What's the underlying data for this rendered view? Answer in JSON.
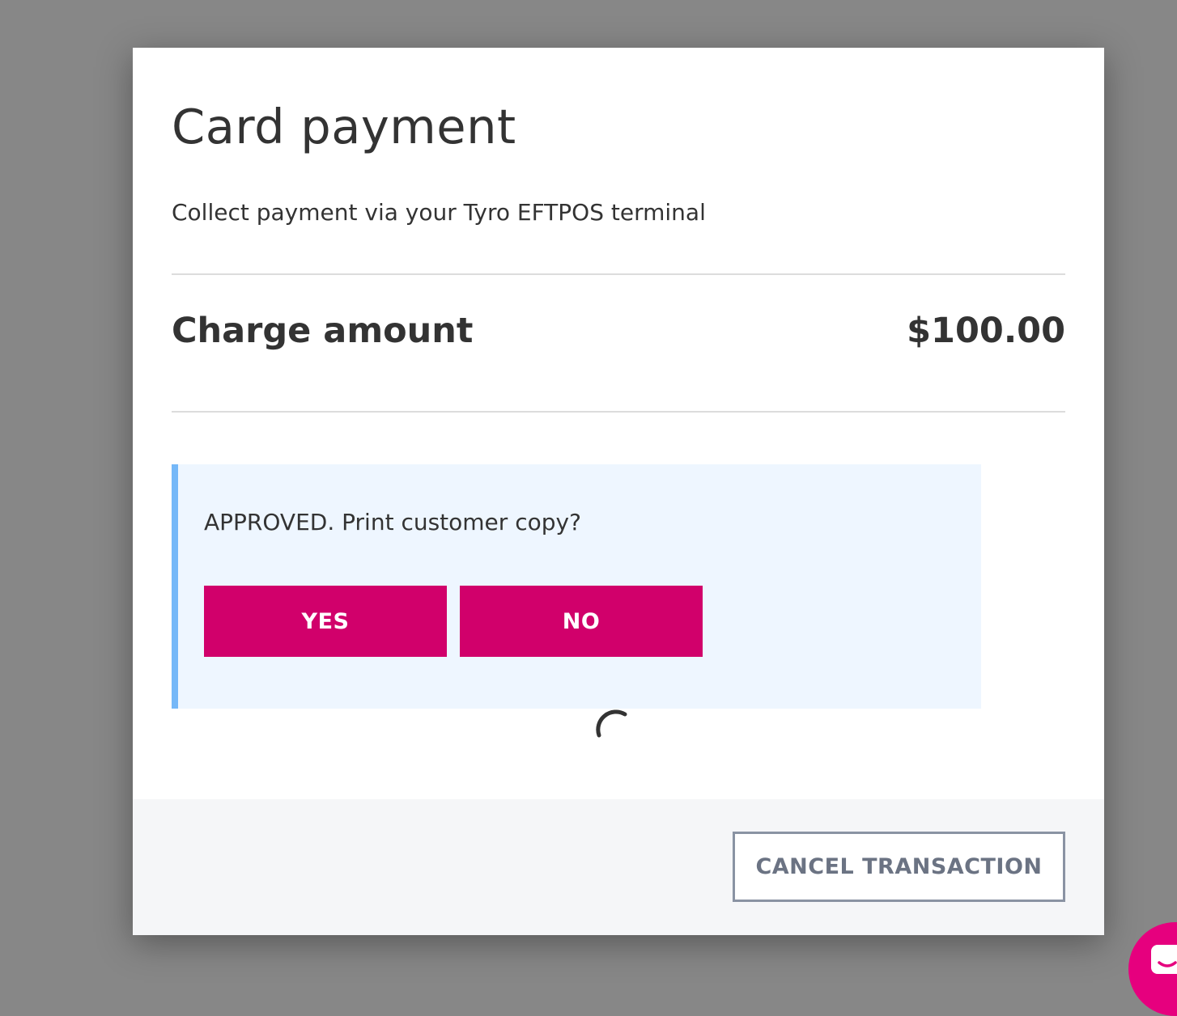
{
  "modal": {
    "title": "Card payment",
    "subtitle": "Collect payment via your Tyro EFTPOS terminal",
    "charge": {
      "label": "Charge amount",
      "value": "$100.00"
    },
    "notice": {
      "message": "APPROVED. Print customer copy?",
      "yes_label": "YES",
      "no_label": "NO"
    },
    "spinner_icon": "loading-spinner-icon",
    "footer": {
      "cancel_label": "CANCEL TRANSACTION"
    }
  },
  "chat_launcher": {
    "icon": "chat-icon"
  },
  "colors": {
    "overlay": "#878787",
    "accent": "#d1006b",
    "notice_background": "#eef6ff",
    "notice_border": "#75b8f8",
    "footer_background": "#f5f6f8",
    "chat_launcher": "#e6007e"
  }
}
